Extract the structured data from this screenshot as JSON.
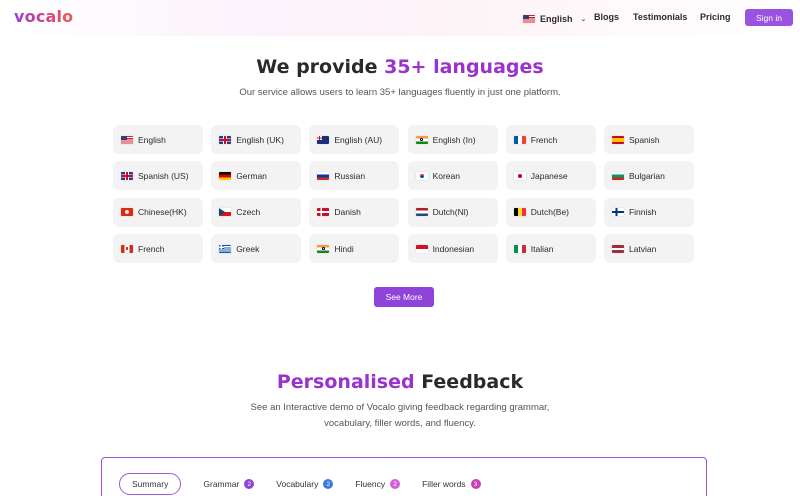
{
  "header": {
    "logo": "vocalo",
    "language_selector": {
      "flag": "us-flag-icon",
      "label": "English"
    },
    "nav": [
      {
        "label": "Blogs"
      },
      {
        "label": "Testimonials"
      },
      {
        "label": "Pricing"
      }
    ],
    "signin_label": "Sign in"
  },
  "languages_section": {
    "title_prefix": "We provide ",
    "title_accent": "35+ languages",
    "subtitle": "Our service allows users to learn 35+ languages fluently in just one platform.",
    "languages": [
      {
        "label": "English",
        "flag": "us-flag-icon"
      },
      {
        "label": "English (UK)",
        "flag": "uk-flag-icon"
      },
      {
        "label": "English (AU)",
        "flag": "au-flag-icon"
      },
      {
        "label": "English (In)",
        "flag": "in-flag-icon"
      },
      {
        "label": "French",
        "flag": "fr-flag-icon"
      },
      {
        "label": "Spanish",
        "flag": "es-flag-icon"
      },
      {
        "label": "Spanish (US)",
        "flag": "uk-flag-icon"
      },
      {
        "label": "German",
        "flag": "de-flag-icon"
      },
      {
        "label": "Russian",
        "flag": "ru-flag-icon"
      },
      {
        "label": "Korean",
        "flag": "kr-flag-icon"
      },
      {
        "label": "Japanese",
        "flag": "jp-flag-icon"
      },
      {
        "label": "Bulgarian",
        "flag": "bg-flag-icon"
      },
      {
        "label": "Chinese(HK)",
        "flag": "hk-flag-icon"
      },
      {
        "label": "Czech",
        "flag": "cz-flag-icon"
      },
      {
        "label": "Danish",
        "flag": "dk-flag-icon"
      },
      {
        "label": "Dutch(Nl)",
        "flag": "nl-flag-icon"
      },
      {
        "label": "Dutch(Be)",
        "flag": "be-flag-icon"
      },
      {
        "label": "Finnish",
        "flag": "fi-flag-icon"
      },
      {
        "label": "French",
        "flag": "ca-flag-icon"
      },
      {
        "label": "Greek",
        "flag": "gr-flag-icon"
      },
      {
        "label": "Hindi",
        "flag": "in-flag-icon"
      },
      {
        "label": "Indonesian",
        "flag": "id-flag-icon"
      },
      {
        "label": "Italian",
        "flag": "it-flag-icon"
      },
      {
        "label": "Latvian",
        "flag": "lv-flag-icon"
      }
    ],
    "see_more_label": "See More"
  },
  "feedback_section": {
    "title_accent": "Personalised",
    "title_rest": " Feedback",
    "subtitle_line1": "See an Interactive demo of Vocalo giving feedback regarding grammar,",
    "subtitle_line2": "vocabulary, filler words, and fluency.",
    "tabs": [
      {
        "label": "Summary",
        "active": true
      },
      {
        "label": "Grammar",
        "count": "2",
        "color": "#8e44d8"
      },
      {
        "label": "Vocabulary",
        "count": "2",
        "color": "#3b7be0"
      },
      {
        "label": "Fluency",
        "count": "2",
        "color": "#d65fd8"
      },
      {
        "label": "Filler words",
        "count": "3",
        "color": "#c93fb8"
      }
    ]
  },
  "colors": {
    "accent_purple": "#9a32cd",
    "button_purple": "#8f43d9",
    "chip_bg": "#f3f3f3"
  }
}
